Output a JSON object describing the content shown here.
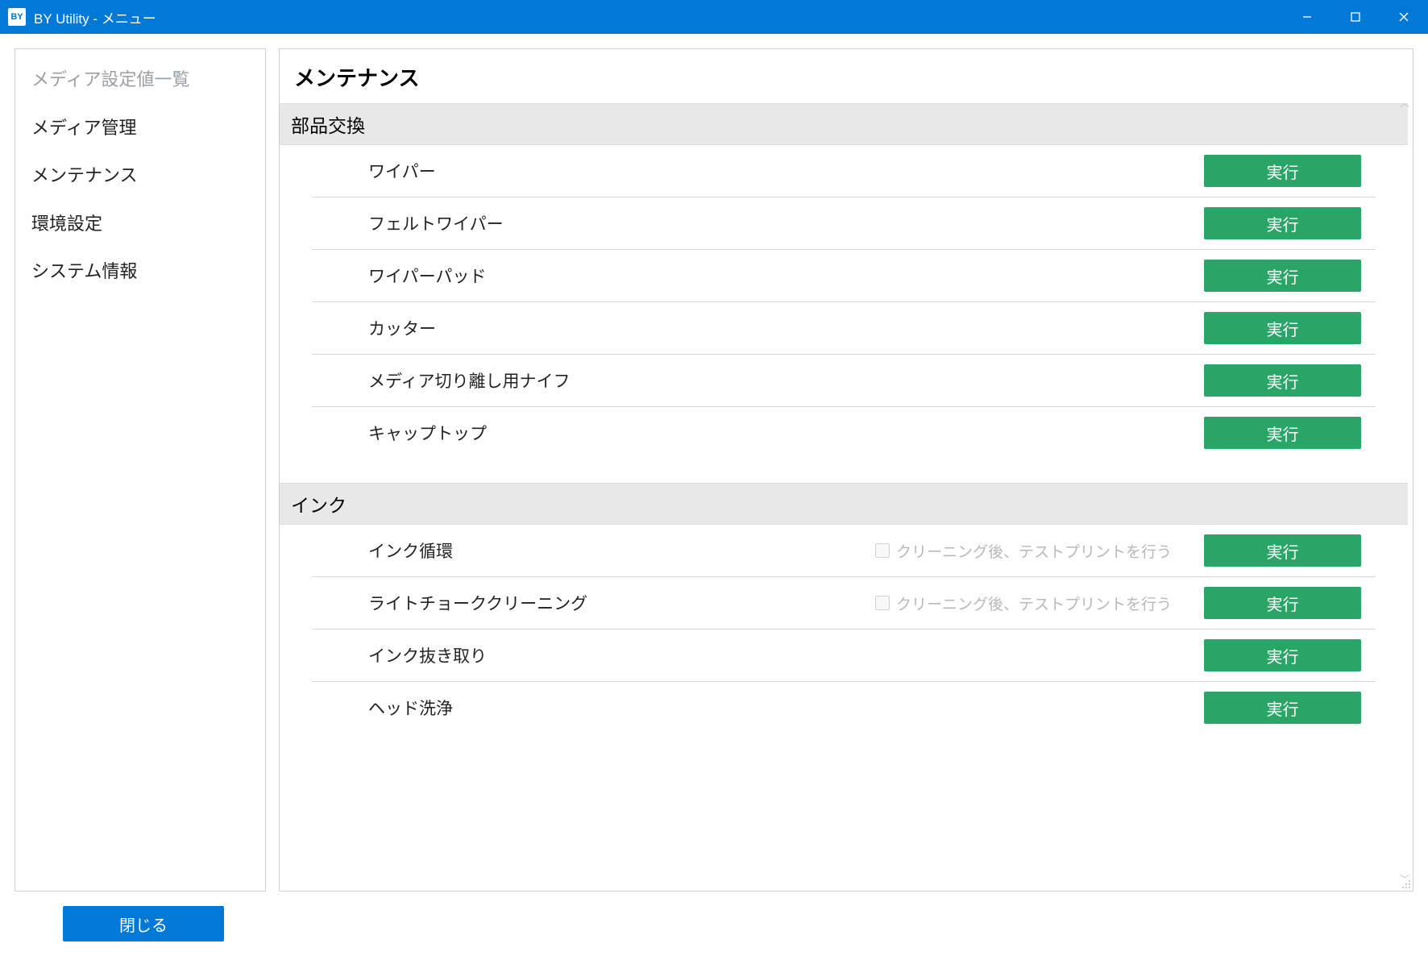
{
  "window": {
    "icon_text": "BY",
    "title": "BY Utility - メニュー"
  },
  "sidebar": {
    "items": [
      {
        "label": "メディア設定値一覧",
        "disabled": true,
        "name": "sidebar-item-media-settings-list"
      },
      {
        "label": "メディア管理",
        "disabled": false,
        "name": "sidebar-item-media-management"
      },
      {
        "label": "メンテナンス",
        "disabled": false,
        "name": "sidebar-item-maintenance"
      },
      {
        "label": "環境設定",
        "disabled": false,
        "name": "sidebar-item-preferences"
      },
      {
        "label": "システム情報",
        "disabled": false,
        "name": "sidebar-item-system-info"
      }
    ]
  },
  "page": {
    "title": "メンテナンス",
    "sections": [
      {
        "name": "section-parts-replacement",
        "header": "部品交換",
        "rows": [
          {
            "label": "ワイパー",
            "name": "row-wiper",
            "button": "実行"
          },
          {
            "label": "フェルトワイパー",
            "name": "row-felt-wiper",
            "button": "実行"
          },
          {
            "label": "ワイパーパッド",
            "name": "row-wiper-pad",
            "button": "実行"
          },
          {
            "label": "カッター",
            "name": "row-cutter",
            "button": "実行"
          },
          {
            "label": "メディア切り離し用ナイフ",
            "name": "row-media-separation-knife",
            "button": "実行"
          },
          {
            "label": "キャップトップ",
            "name": "row-cap-top",
            "button": "実行"
          }
        ]
      },
      {
        "name": "section-ink",
        "header": "インク",
        "rows": [
          {
            "label": "インク循環",
            "name": "row-ink-circulation",
            "button": "実行",
            "checkbox": {
              "label": "クリーニング後、テストプリントを行う",
              "disabled": true
            }
          },
          {
            "label": "ライトチョーククリーニング",
            "name": "row-light-choke-cleaning",
            "button": "実行",
            "checkbox": {
              "label": "クリーニング後、テストプリントを行う",
              "disabled": true
            }
          },
          {
            "label": "インク抜き取り",
            "name": "row-ink-drain",
            "button": "実行"
          },
          {
            "label": "ヘッド洗浄",
            "name": "row-head-wash",
            "button": "実行"
          }
        ]
      }
    ]
  },
  "footer": {
    "close_label": "閉じる"
  }
}
